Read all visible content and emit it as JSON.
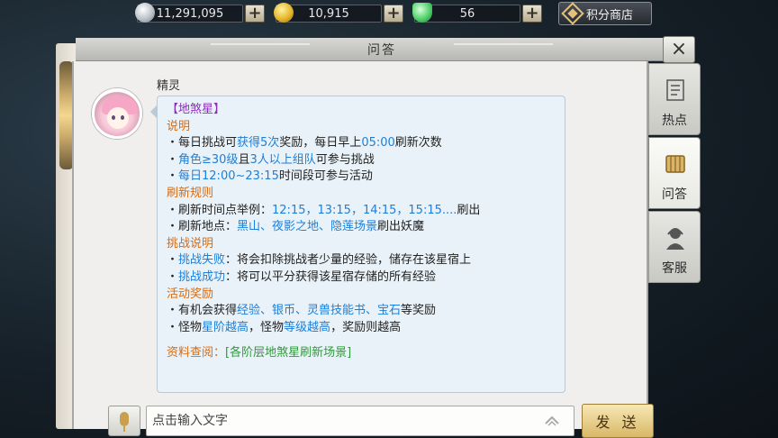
{
  "currencies": [
    {
      "icon": "silver-coin-icon",
      "value": "11,291,095"
    },
    {
      "icon": "gold-coin-icon",
      "value": "10,915"
    },
    {
      "icon": "jade-gem-icon",
      "value": "56"
    }
  ],
  "shop_button": "积分商店",
  "window": {
    "title": "问答",
    "close": "×"
  },
  "message": {
    "sender": "精灵",
    "lines": [
      {
        "segments": [
          {
            "text": "【地煞星】",
            "color": "purple"
          }
        ]
      },
      {
        "segments": [
          {
            "text": "说明",
            "color": "orange"
          }
        ]
      },
      {
        "segments": [
          {
            "text": "・每日挑战可",
            "color": "default"
          },
          {
            "text": "获得5次",
            "color": "blue"
          },
          {
            "text": "奖励，每日早上",
            "color": "default"
          },
          {
            "text": "05:00",
            "color": "blue"
          },
          {
            "text": "刷新次数",
            "color": "default"
          }
        ]
      },
      {
        "segments": [
          {
            "text": "・",
            "color": "default"
          },
          {
            "text": "角色≥30级",
            "color": "blue"
          },
          {
            "text": "且",
            "color": "default"
          },
          {
            "text": "3人以上组队",
            "color": "blue"
          },
          {
            "text": "可参与挑战",
            "color": "default"
          }
        ]
      },
      {
        "segments": [
          {
            "text": "・",
            "color": "default"
          },
          {
            "text": "每日12:00~23:15",
            "color": "blue"
          },
          {
            "text": "时间段可参与活动",
            "color": "default"
          }
        ]
      },
      {
        "segments": [
          {
            "text": "刷新规则",
            "color": "orange"
          }
        ]
      },
      {
        "segments": [
          {
            "text": "・刷新时间点举例：",
            "color": "default"
          },
          {
            "text": "12:15，13:15，14:15，15:15....",
            "color": "blue"
          },
          {
            "text": "刷出",
            "color": "default"
          }
        ]
      },
      {
        "segments": [
          {
            "text": "・刷新地点：",
            "color": "default"
          },
          {
            "text": "黑山、夜影之地、隐莲场景",
            "color": "blue"
          },
          {
            "text": "刷出妖魔",
            "color": "default"
          }
        ]
      },
      {
        "segments": [
          {
            "text": "挑战说明",
            "color": "orange"
          }
        ]
      },
      {
        "segments": [
          {
            "text": "・",
            "color": "default"
          },
          {
            "text": "挑战失败",
            "color": "blue"
          },
          {
            "text": "：将会扣除挑战者少量的经验，储存在该星宿上",
            "color": "default"
          }
        ]
      },
      {
        "segments": [
          {
            "text": "・",
            "color": "default"
          },
          {
            "text": "挑战成功",
            "color": "blue"
          },
          {
            "text": "：将可以平分获得该星宿存储的所有经验",
            "color": "default"
          }
        ]
      },
      {
        "segments": [
          {
            "text": "活动奖励",
            "color": "orange"
          }
        ]
      },
      {
        "segments": [
          {
            "text": "・有机会获得",
            "color": "default"
          },
          {
            "text": "经验、银币、灵兽技能书、宝石",
            "color": "blue"
          },
          {
            "text": "等奖励",
            "color": "default"
          }
        ]
      },
      {
        "segments": [
          {
            "text": "・怪物",
            "color": "default"
          },
          {
            "text": "星阶越高",
            "color": "blue"
          },
          {
            "text": "，怪物",
            "color": "default"
          },
          {
            "text": "等级越高",
            "color": "blue"
          },
          {
            "text": "，奖励则越高",
            "color": "default"
          }
        ]
      }
    ],
    "reference": {
      "label": "资料查阅：",
      "link": "[各阶层地煞星刷新场景]"
    }
  },
  "input": {
    "placeholder": "点击输入文字",
    "send_label": "发 送"
  },
  "tabs": [
    {
      "label": "热点",
      "icon": "scroll-icon",
      "active": false
    },
    {
      "label": "问答",
      "icon": "bamboo-scroll-icon",
      "active": true
    },
    {
      "label": "客服",
      "icon": "headset-icon",
      "active": false
    }
  ],
  "colors": {
    "purple": "#8a2fb8",
    "orange": "#d86b12",
    "blue": "#1c7fd9",
    "green": "#2f9a3a",
    "default": "#222222"
  }
}
